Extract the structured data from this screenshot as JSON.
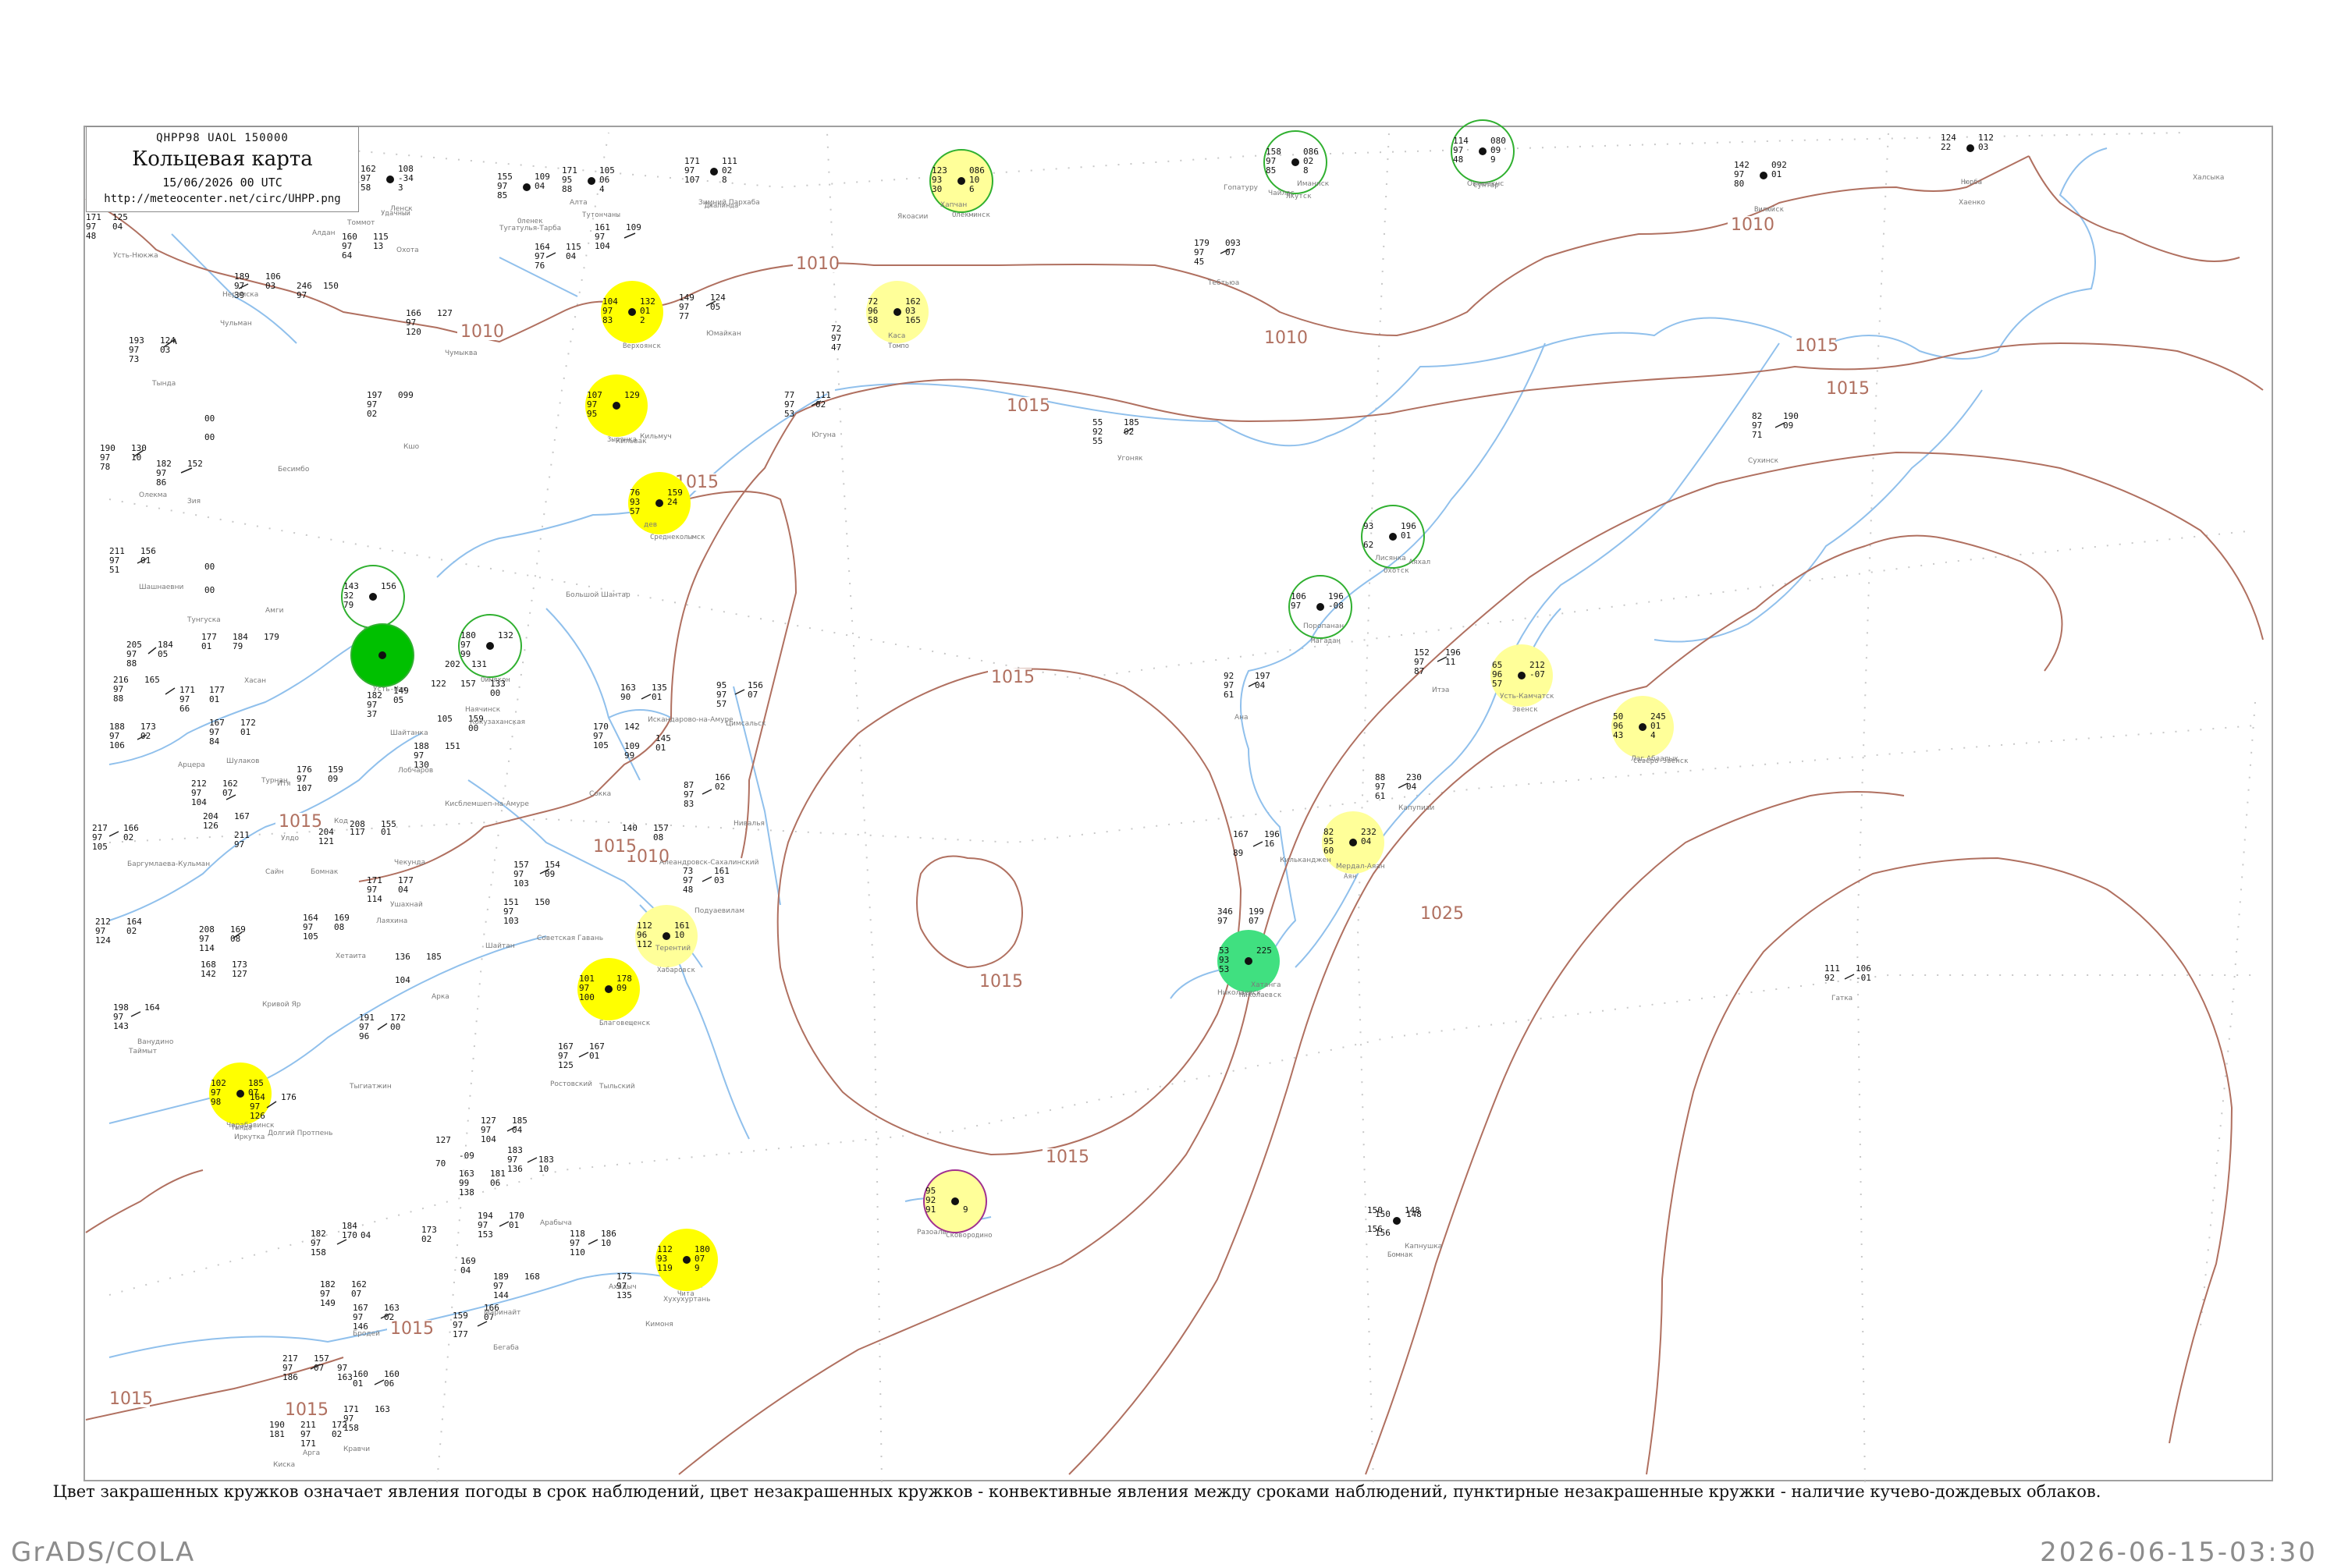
{
  "legend": {
    "code_line": "QHPP98  UAOL  150000",
    "title": "Кольцевая карта",
    "date": "15/06/2026 00 UTC",
    "url": "http://meteocenter.net/circ/UHPP.png"
  },
  "caption": "Цвет закрашенных кружков означает явления погоды в срок наблюдений, цвет незакрашенных кружков - конвективные явления между сроками наблюдений, пунктирные незакрашенные кружки - наличие кучево-дождевых облаков.",
  "footer": {
    "left": "GrADS/COLA",
    "right": "2026-06-15-03:30"
  },
  "colors": {
    "isobar": "#b07060",
    "coast": "#90c0ec",
    "frame": "#a0a0a0",
    "fill_yellow": "#ffff00",
    "fill_lightyellow": "#ffff99",
    "fill_green": "#00c000",
    "fill_lightgreen": "#40e080",
    "ring_green": "#30b030",
    "ring_purple": "#a03090"
  },
  "isobar_labels": [
    {
      "text": "1010"
    },
    {
      "text": "1010"
    },
    {
      "text": "1010"
    },
    {
      "text": "1010"
    },
    {
      "text": "1015"
    },
    {
      "text": "1015"
    },
    {
      "text": "1015"
    },
    {
      "text": "1015"
    },
    {
      "text": "1015"
    },
    {
      "text": "1015"
    },
    {
      "text": "1015"
    },
    {
      "text": "1015"
    },
    {
      "text": "1010"
    },
    {
      "text": "1015"
    },
    {
      "text": "1025"
    },
    {
      "text": "1015"
    },
    {
      "text": "1015"
    },
    {
      "text": "1015"
    }
  ],
  "stations": [
    {
      "name": "Удачный",
      "vals": [
        "162",
        "97",
        "58"
      ],
      "rvals": [
        "108",
        "-34",
        "3"
      ],
      "symbol": "none"
    },
    {
      "name": "Оленек",
      "vals": [
        "155",
        "97",
        "85"
      ],
      "rvals": [
        "109",
        "04",
        ""
      ],
      "symbol": "none"
    },
    {
      "name": "Тутончаны",
      "vals": [
        "171",
        "95",
        "88"
      ],
      "rvals": [
        "105",
        "06",
        "4"
      ],
      "symbol": "none"
    },
    {
      "name": "Джалинда",
      "vals": [
        "171",
        "97",
        "107"
      ],
      "rvals": [
        "111",
        "02",
        "8"
      ],
      "symbol": "none"
    },
    {
      "name": "Олекминск",
      "vals": [
        "123",
        "93",
        "30"
      ],
      "rvals": [
        "086",
        "10",
        "6"
      ],
      "symbol": "fill_lightyellow",
      "ring": "ring_green"
    },
    {
      "name": "Якутск",
      "vals": [
        "158",
        "97",
        "85"
      ],
      "rvals": [
        "086",
        "02",
        "8"
      ],
      "symbol": "none",
      "ring": "ring_green"
    },
    {
      "name": "Сунтар",
      "vals": [
        "114",
        "97",
        "48"
      ],
      "rvals": [
        "080",
        "09",
        "9"
      ],
      "symbol": "none",
      "ring": "ring_green"
    },
    {
      "name": "Нюрба",
      "vals": [
        "124",
        "22",
        ""
      ],
      "rvals": [
        "112",
        "03",
        ""
      ],
      "symbol": "none"
    },
    {
      "name": "Вилюйск",
      "vals": [
        "142",
        "97",
        "80"
      ],
      "rvals": [
        "092",
        "01",
        ""
      ],
      "symbol": "none"
    },
    {
      "name": "Верхоянск",
      "vals": [
        "104",
        "97",
        "83"
      ],
      "rvals": [
        "132",
        "01",
        "2"
      ],
      "symbol": "fill_yellow"
    },
    {
      "name": "Томпо",
      "vals": [
        "72",
        "96",
        "58"
      ],
      "rvals": [
        "162",
        "03",
        "165"
      ],
      "symbol": "fill_lightyellow"
    },
    {
      "name": "Зырянка",
      "vals": [
        "107",
        "97",
        "95"
      ],
      "rvals": [
        "129",
        "",
        ""
      ],
      "symbol": "fill_yellow"
    },
    {
      "name": "Среднеколымск",
      "vals": [
        "76",
        "93",
        "57"
      ],
      "rvals": [
        "159",
        "24",
        ""
      ],
      "symbol": "fill_yellow"
    },
    {
      "name": "Чокурдах",
      "vals": [
        "143",
        "32",
        "79"
      ],
      "rvals": [
        "156",
        "",
        ""
      ],
      "symbol": "none",
      "ring": "ring_green"
    },
    {
      "name": "Усть-Мая",
      "vals": [
        "",
        "",
        ""
      ],
      "rvals": [
        "",
        "",
        ""
      ],
      "symbol": "fill_green",
      "ring": "ring_green"
    },
    {
      "name": "Оймякон",
      "vals": [
        "180",
        "97",
        "99"
      ],
      "rvals": [
        "132",
        "",
        ""
      ],
      "symbol": "none",
      "ring": "ring_green"
    },
    {
      "name": "Охотск",
      "vals": [
        "93",
        "",
        "62"
      ],
      "rvals": [
        "196",
        "01",
        ""
      ],
      "symbol": "none",
      "ring": "ring_green"
    },
    {
      "name": "Магадан",
      "vals": [
        "106",
        "97",
        ""
      ],
      "rvals": [
        "196",
        "-08",
        ""
      ],
      "symbol": "none",
      "ring": "ring_green"
    },
    {
      "name": "Эвенск",
      "vals": [
        "65",
        "96",
        "57"
      ],
      "rvals": [
        "212",
        "-07",
        ""
      ],
      "symbol": "fill_lightyellow"
    },
    {
      "name": "Северо-Эвенск",
      "vals": [
        "50",
        "96",
        "43"
      ],
      "rvals": [
        "245",
        "01",
        "4"
      ],
      "symbol": "fill_lightyellow"
    },
    {
      "name": "Аян",
      "vals": [
        "82",
        "95",
        "60"
      ],
      "rvals": [
        "232",
        "04",
        ""
      ],
      "symbol": "fill_lightyellow"
    },
    {
      "name": "Николаевск",
      "vals": [
        "53",
        "93",
        "53"
      ],
      "rvals": [
        "225",
        "",
        ""
      ],
      "symbol": "fill_lightgreen"
    },
    {
      "name": "Хабаровск",
      "vals": [
        "112",
        "96",
        "112"
      ],
      "rvals": [
        "161",
        "10",
        ""
      ],
      "symbol": "fill_lightyellow"
    },
    {
      "name": "Благовещенск",
      "vals": [
        "101",
        "97",
        "100"
      ],
      "rvals": [
        "178",
        "09",
        ""
      ],
      "symbol": "fill_yellow"
    },
    {
      "name": "Тында",
      "vals": [
        "102",
        "97",
        "98"
      ],
      "rvals": [
        "185",
        "07",
        ""
      ],
      "symbol": "fill_yellow"
    },
    {
      "name": "Чита",
      "vals": [
        "112",
        "93",
        "119"
      ],
      "rvals": [
        "180",
        "07",
        "9"
      ],
      "symbol": "fill_yellow"
    },
    {
      "name": "Сковородино",
      "vals": [
        "95",
        "92",
        "91"
      ],
      "rvals": [
        "",
        "",
        "9"
      ],
      "symbol": "fill_lightyellow",
      "ring": "ring_purple"
    },
    {
      "name": "Бомнак",
      "vals": [
        "150",
        "",
        "156"
      ],
      "rvals": [
        "148",
        "",
        ""
      ],
      "symbol": "none"
    }
  ]
}
